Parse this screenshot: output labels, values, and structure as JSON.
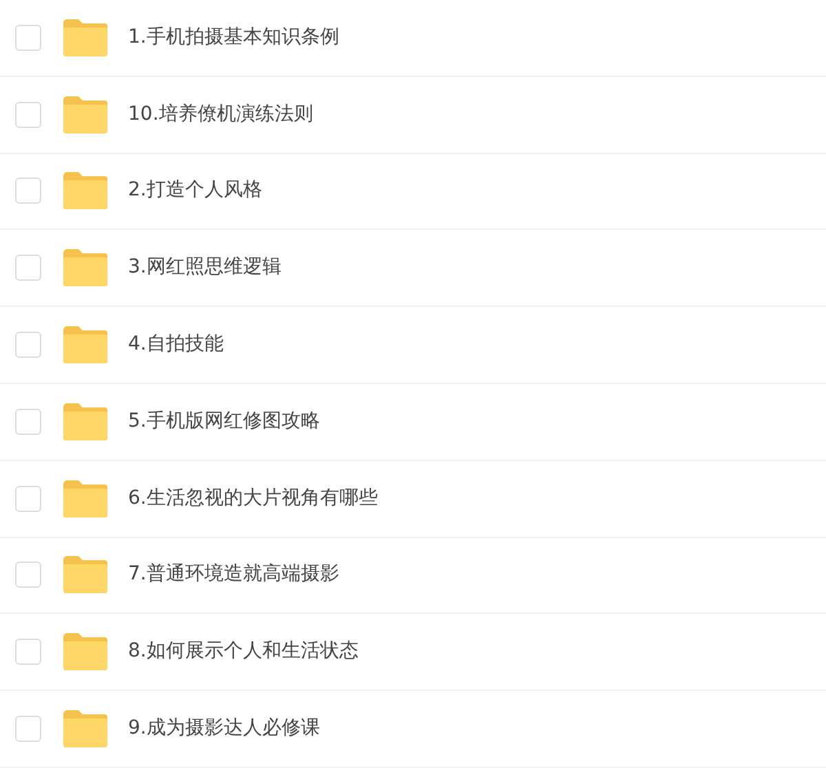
{
  "files": [
    {
      "name": "1.手机拍摄基本知识条例",
      "checked": false
    },
    {
      "name": "10.培养僚机演练法则",
      "checked": false
    },
    {
      "name": "2.打造个人风格",
      "checked": false
    },
    {
      "name": "3.网红照思维逻辑",
      "checked": false
    },
    {
      "name": "4.自拍技能",
      "checked": false
    },
    {
      "name": "5.手机版网红修图攻略",
      "checked": false
    },
    {
      "name": "6.生活忽视的大片视角有哪些",
      "checked": false
    },
    {
      "name": "7.普通环境造就高端摄影",
      "checked": false
    },
    {
      "name": "8.如何展示个人和生活状态",
      "checked": false
    },
    {
      "name": "9.成为摄影达人必修课",
      "checked": false
    }
  ]
}
